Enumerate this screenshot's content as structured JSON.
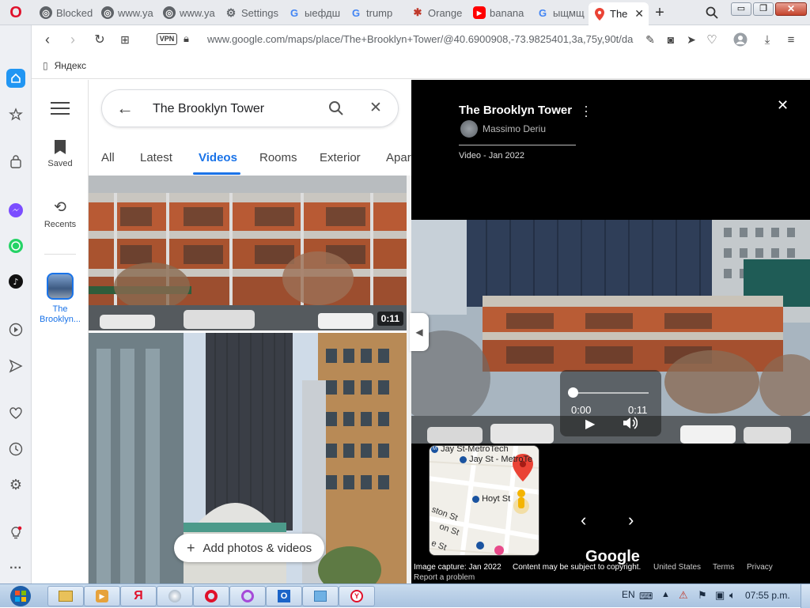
{
  "browser": {
    "tabs": [
      {
        "label": "Blocked",
        "icon": "globe-icon"
      },
      {
        "label": "www.ya",
        "icon": "globe-icon"
      },
      {
        "label": "www.ya",
        "icon": "globe-icon"
      },
      {
        "label": "Settings",
        "icon": "gear-icon"
      },
      {
        "label": "ыефдш",
        "icon": "google-icon"
      },
      {
        "label": "trump",
        "icon": "google-icon"
      },
      {
        "label": "Orange",
        "icon": "spider-icon"
      },
      {
        "label": "banana",
        "icon": "youtube-icon"
      },
      {
        "label": "ыщмщ",
        "icon": "google-icon"
      },
      {
        "label": "The",
        "icon": "maps-pin-icon"
      }
    ],
    "url": "www.google.com/maps/place/The+Brooklyn+Tower/@40.6900908,-73.9825401,3a,75y,90t/da",
    "vpn_label": "VPN",
    "bookmark": "Яндекс"
  },
  "maps": {
    "rail": {
      "saved": "Saved",
      "recents": "Recents",
      "place": "The Brooklyn..."
    },
    "search_value": "The Brooklyn Tower",
    "tabs": [
      "All",
      "Latest",
      "Videos",
      "Rooms",
      "Exterior",
      "Apar"
    ],
    "active_tab": "Videos",
    "video_duration": "0:11",
    "add_button": "Add photos & videos"
  },
  "viewer": {
    "title": "The Brooklyn Tower",
    "author": "Massimo Deriu",
    "meta": "Video - Jan 2022",
    "player": {
      "current": "0:00",
      "total": "0:11",
      "progress": 0.0
    },
    "minimap": {
      "labels": [
        "Jay St-MetroTech",
        "Jay St - MetroTe",
        "Hoyt St",
        "ston St",
        "on St",
        "e St"
      ]
    },
    "logo": "Google",
    "footer": {
      "capture": "Image capture: Jan 2022",
      "copyright": "Content may be subject to copyright.",
      "region": "United States",
      "terms": "Terms",
      "privacy": "Privacy",
      "report": "Report a problem"
    }
  },
  "taskbar": {
    "lang": "EN",
    "time": "07:55 p.m."
  },
  "colors": {
    "accent": "#1a73e8",
    "opera_red": "#e0112b",
    "viewer_bg": "#000000"
  }
}
